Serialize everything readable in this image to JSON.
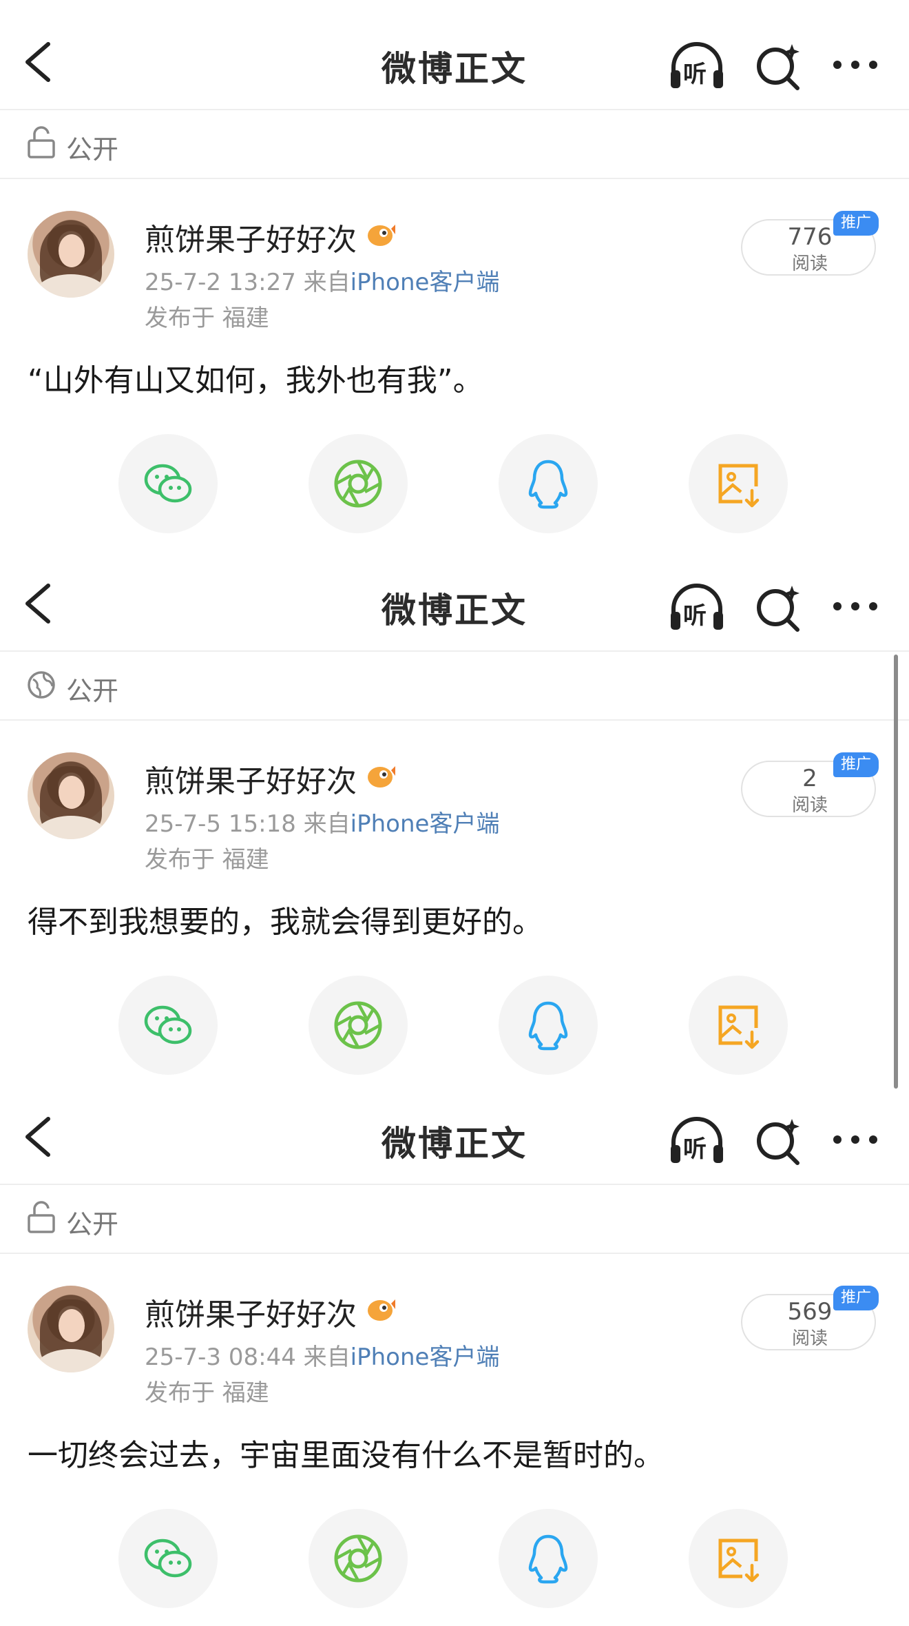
{
  "posts": [
    {
      "header": {
        "title": "微博正文",
        "listen_label": "听"
      },
      "visibility": {
        "label": "公开",
        "icon": "unlock-icon"
      },
      "author": {
        "name": "煎饼果子好好次"
      },
      "meta": {
        "time": "25-7-2 13:27",
        "from_prefix": "来自",
        "source": "iPhone客户端",
        "location": "发布于 福建"
      },
      "reads": {
        "count": "776",
        "label": "阅读",
        "badge": "推广"
      },
      "content": "“山外有山又如何，我外也有我”。"
    },
    {
      "header": {
        "title": "微博正文",
        "listen_label": "听"
      },
      "visibility": {
        "label": "公开",
        "icon": "globe-icon"
      },
      "author": {
        "name": "煎饼果子好好次"
      },
      "meta": {
        "time": "25-7-5 15:18",
        "from_prefix": "来自",
        "source": "iPhone客户端",
        "location": "发布于 福建"
      },
      "reads": {
        "count": "2",
        "label": "阅读",
        "badge": "推广"
      },
      "content": "得不到我想要的，我就会得到更好的。"
    },
    {
      "header": {
        "title": "微博正文",
        "listen_label": "听"
      },
      "visibility": {
        "label": "公开",
        "icon": "unlock-icon"
      },
      "author": {
        "name": "煎饼果子好好次"
      },
      "meta": {
        "time": "25-7-3 08:44",
        "from_prefix": "来自",
        "source": "iPhone客户端",
        "location": "发布于 福建"
      },
      "reads": {
        "count": "569",
        "label": "阅读",
        "badge": "推广"
      },
      "content": "一切终会过去，宇宙里面没有什么不是暂时的。"
    }
  ],
  "share_icons": [
    "wechat-icon",
    "moments-icon",
    "qq-icon",
    "save-image-icon"
  ],
  "colors": {
    "link": "#4f7fb6",
    "wechat": "#3dbf6a",
    "moments": "#6cc24a",
    "qq": "#2aa6f0",
    "save": "#f5a623",
    "promo": "#3b8cf2"
  }
}
